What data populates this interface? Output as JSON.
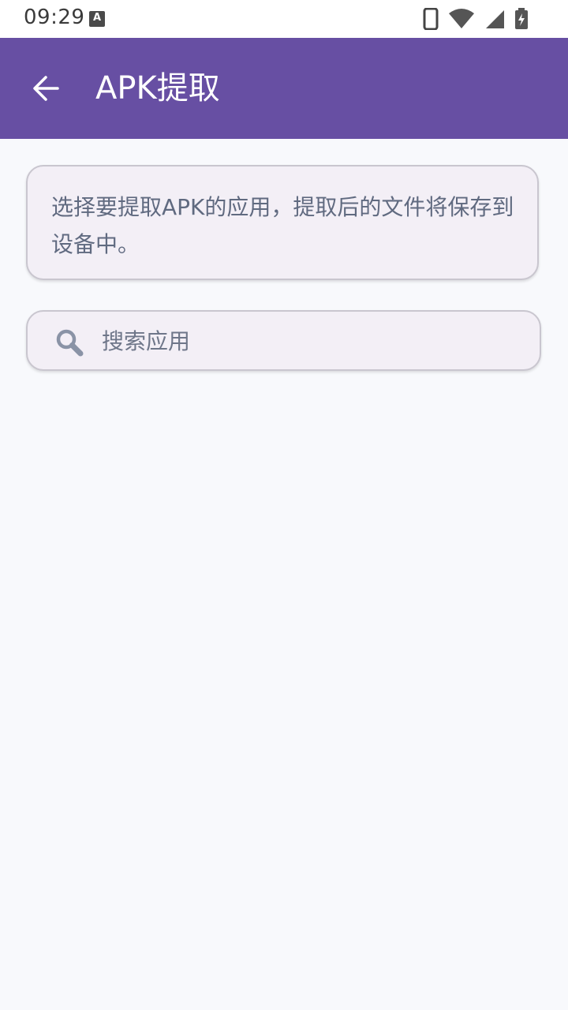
{
  "status_bar": {
    "time": "09:29",
    "notification_badge": "A"
  },
  "app_bar": {
    "title": "APK提取",
    "back_icon": "arrow-back-icon"
  },
  "info_card": {
    "text": "选择要提取APK的应用，提取后的文件将保存到设备中。"
  },
  "search": {
    "placeholder": "搜索应用",
    "value": "",
    "icon": "search-icon"
  },
  "colors": {
    "primary": "#674fa3",
    "background": "#f8f9fc",
    "card_background": "#f3eff6",
    "text_secondary": "#606a80"
  }
}
